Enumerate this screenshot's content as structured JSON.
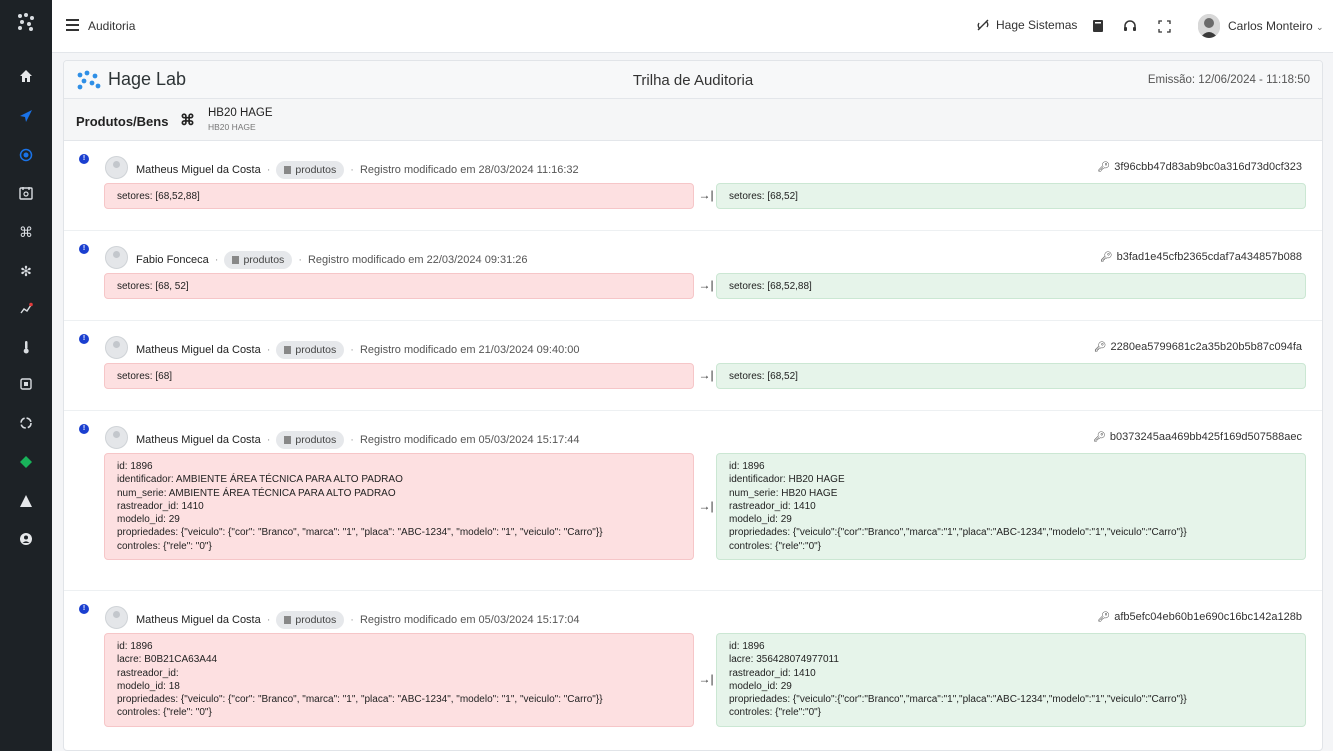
{
  "topbar": {
    "title": "Auditoria",
    "org": "Hage Sistemas",
    "user": "Carlos Monteiro"
  },
  "card": {
    "brand": "Hage Lab",
    "title": "Trilha de Auditoria",
    "emission": "Emissão: 12/06/2024 - 11:18:50",
    "section_label": "Produtos/Bens",
    "product_name": "HB20 HAGE",
    "product_sub": "HB20 HAGE"
  },
  "entries": [
    {
      "user": "Matheus Miguel da Costa",
      "badge": "produtos",
      "message": "Registro modificado em 28/03/2024 11:16:32",
      "hash": "3f96cbb47d83ab9bc0a316d73d0cf323",
      "old": [
        "setores: [68,52,88]"
      ],
      "new": [
        "setores: [68,52]"
      ]
    },
    {
      "user": "Fabio Fonceca",
      "badge": "produtos",
      "message": "Registro modificado em 22/03/2024 09:31:26",
      "hash": "b3fad1e45cfb2365cdaf7a434857b088",
      "old": [
        "setores: [68, 52]"
      ],
      "new": [
        "setores: [68,52,88]"
      ]
    },
    {
      "user": "Matheus Miguel da Costa",
      "badge": "produtos",
      "message": "Registro modificado em 21/03/2024 09:40:00",
      "hash": "2280ea5799681c2a35b20b5b87c094fa",
      "old": [
        "setores: [68]"
      ],
      "new": [
        "setores: [68,52]"
      ]
    },
    {
      "user": "Matheus Miguel da Costa",
      "badge": "produtos",
      "message": "Registro modificado em 05/03/2024 15:17:44",
      "hash": "b0373245aa469bb425f169d507588aec",
      "old": [
        "id: 1896",
        "identificador: AMBIENTE ÁREA TÉCNICA PARA ALTO PADRAO",
        "num_serie: AMBIENTE ÁREA TÉCNICA PARA ALTO PADRAO",
        "rastreador_id: 1410",
        "modelo_id: 29",
        "propriedades: {\"veiculo\": {\"cor\": \"Branco\", \"marca\": \"1\", \"placa\": \"ABC-1234\", \"modelo\": \"1\", \"veiculo\": \"Carro\"}}",
        "controles: {\"rele\": \"0\"}"
      ],
      "new": [
        "id: 1896",
        "identificador: HB20 HAGE",
        "num_serie: HB20 HAGE",
        "rastreador_id: 1410",
        "modelo_id: 29",
        "propriedades: {\"veiculo\":{\"cor\":\"Branco\",\"marca\":\"1\",\"placa\":\"ABC-1234\",\"modelo\":\"1\",\"veiculo\":\"Carro\"}}",
        "controles: {\"rele\":\"0\"}"
      ]
    },
    {
      "user": "Matheus Miguel da Costa",
      "badge": "produtos",
      "message": "Registro modificado em 05/03/2024 15:17:04",
      "hash": "afb5efc04eb60b1e690c16bc142a128b",
      "old": [
        "id: 1896",
        "lacre: B0B21CA63A44",
        "rastreador_id:",
        "modelo_id: 18",
        "propriedades: {\"veiculo\": {\"cor\": \"Branco\", \"marca\": \"1\", \"placa\": \"ABC-1234\", \"modelo\": \"1\", \"veiculo\": \"Carro\"}}",
        "controles: {\"rele\": \"0\"}"
      ],
      "new": [
        "id: 1896",
        "lacre: 356428074977011",
        "rastreador_id: 1410",
        "modelo_id: 29",
        "propriedades: {\"veiculo\":{\"cor\":\"Branco\",\"marca\":\"1\",\"placa\":\"ABC-1234\",\"modelo\":\"1\",\"veiculo\":\"Carro\"}}",
        "controles: {\"rele\":\"0\"}"
      ]
    }
  ],
  "sidebar": {
    "icons": [
      "home-icon",
      "send-icon",
      "target-icon",
      "calendar-search-icon",
      "command-icon",
      "cog-icon",
      "network-icon",
      "thermometer-icon",
      "chip-icon",
      "loader-icon",
      "diamond-icon",
      "warning-icon",
      "user-circle-icon"
    ],
    "active_color": "#1a73e8",
    "accent_color": "#19b35a"
  }
}
